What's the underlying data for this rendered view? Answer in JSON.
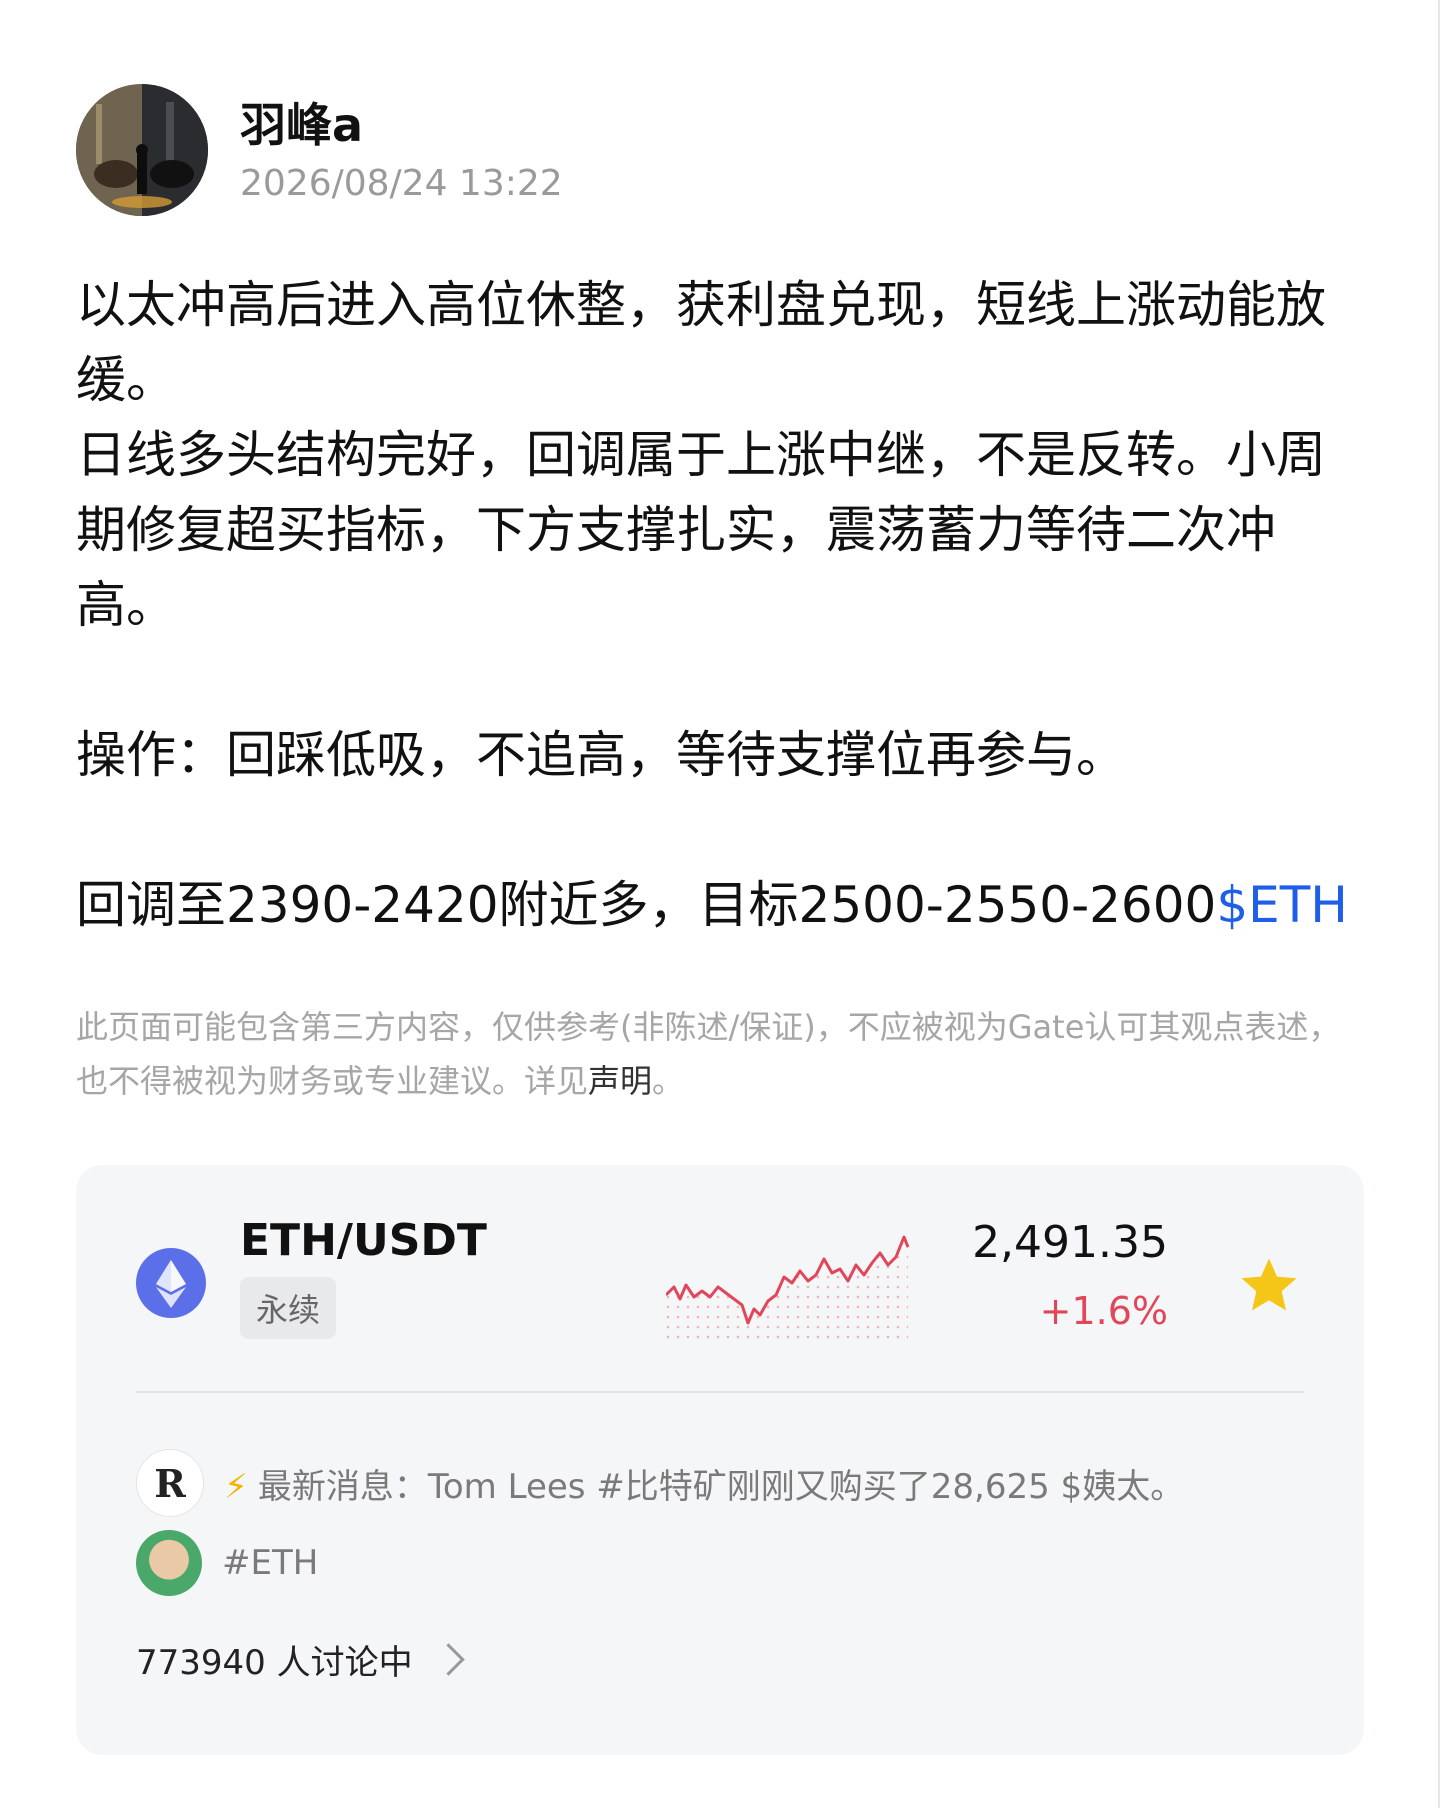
{
  "author": {
    "name": "羽峰a",
    "timestamp": "2026/08/24 13:22"
  },
  "post": {
    "line1": "以太冲高后进入高位休整，获利盘兑现，短线上涨动能放",
    "line2": "缓。",
    "line3": "日线多头结构完好，回调属于上涨中继，不是反转。小周",
    "line4": "期修复超买指标，下方支撑扎实，震荡蓄力等待二次冲",
    "line5": "高。",
    "operation": "操作：回踩低吸，不追高，等待支撑位再参与。",
    "plan_text": "回调至2390-2420附近多，目标2500-2550-2600",
    "cashtag": "$ETH"
  },
  "disclaimer": {
    "text": "此页面可能包含第三方内容，仅供参考(非陈述/保证)，不应被视为Gate认可其观点表述，也不得被视为财务或专业建议。详见",
    "link": "声明",
    "tail": "。"
  },
  "ticker": {
    "pair": "ETH/USDT",
    "badge": "永续",
    "price": "2,491.35",
    "change": "+1.6%",
    "icon": "ethereum-icon",
    "favorite_icon": "star-icon",
    "colors": {
      "up": "#e0475a",
      "star": "#f5c518",
      "eth": "#5b70e8"
    }
  },
  "news": {
    "prefix": "最新消息：",
    "text": "Tom Lees #比特矿刚刚又购买了28,625 $姨太。",
    "avatar_letter": "R"
  },
  "tag": {
    "label": "#ETH"
  },
  "discussion": {
    "label": "773940 人讨论中"
  }
}
